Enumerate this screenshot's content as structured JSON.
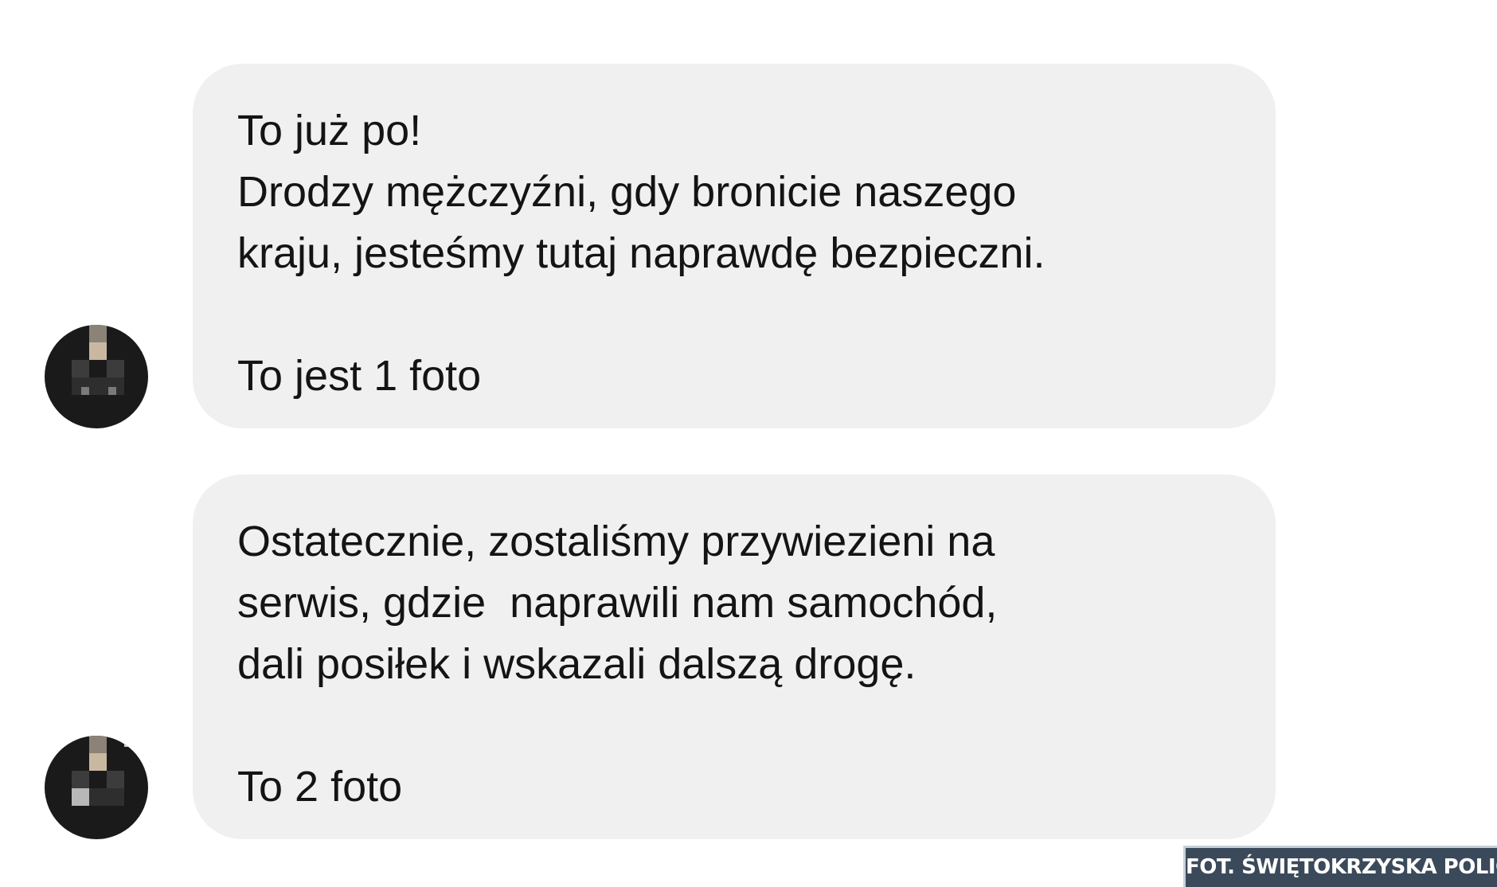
{
  "messages": [
    {
      "lines": [
        "To już po!",
        "Drodzy mężczyźni, gdy bronicie naszego",
        "kraju, jesteśmy tutaj naprawdę bezpieczni."
      ],
      "footer": "To jest 1 foto"
    },
    {
      "lines": [
        "Ostatecznie, zostaliśmy przywiezieni na",
        "serwis, gdzie  naprawili nam samochód,",
        "dali posiłek i wskazali dalszą drogę."
      ],
      "footer": "To 2 foto"
    }
  ],
  "credit": "FOT. ŚWIĘTOKRZYSKA POLICJA",
  "colors": {
    "bubble": "#f0f0f0",
    "text": "#141414",
    "avatar": "#1a1a1a",
    "credit_bg": "#3a4a5a"
  }
}
